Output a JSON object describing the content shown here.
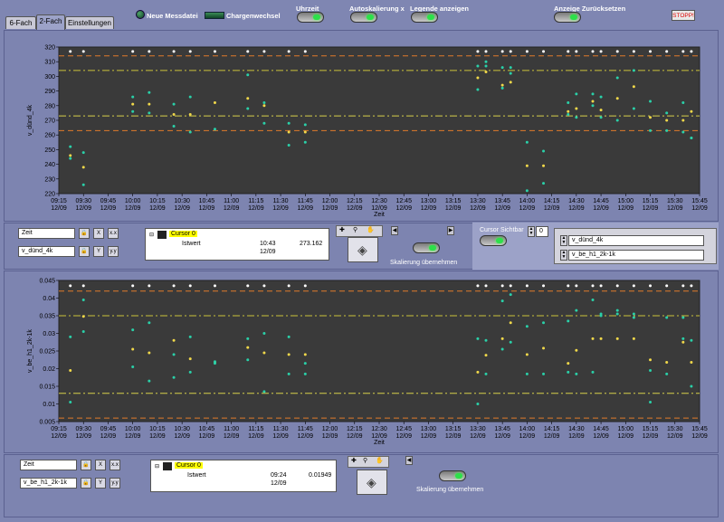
{
  "tabs": [
    "6-Fach",
    "2-Fach",
    "Einstellungen"
  ],
  "active_tab": 1,
  "header": {
    "new_file_label": "Neue Messdatei",
    "batch_change_label": "Chargenwechsel",
    "time_label": "Uhrzeit",
    "autoscale_label": "Autoskalierung x",
    "legend_label": "Legende anzeigen",
    "reset_label": "Anzeige Zurücksetzen",
    "stop_label": "STOPP!"
  },
  "chart_data": [
    {
      "type": "scatter",
      "title": "",
      "xlabel": "Zeit",
      "ylabel": "v_dünd_4k",
      "xticks": [
        "09:15\n12/09",
        "09:30\n12/09",
        "09:45\n12/09",
        "10:00\n12/09",
        "10:15\n12/09",
        "10:30\n12/09",
        "10:45\n12/09",
        "11:00\n12/09",
        "11:15\n12/09",
        "11:30\n12/09",
        "11:45\n12/09",
        "12:00\n12/09",
        "12:15\n12/09",
        "12:30\n12/09",
        "12:45\n12/09",
        "13:00\n12/09",
        "13:15\n12/09",
        "13:30\n12/09",
        "13:45\n12/09",
        "14:00\n12/09",
        "14:15\n12/09",
        "14:30\n12/09",
        "14:45\n12/09",
        "15:00\n12/09",
        "15:15\n12/09",
        "15:30\n12/09",
        "15:45\n12/09"
      ],
      "xlim": [
        555,
        945
      ],
      "ylim": [
        220,
        320
      ],
      "yticks": [
        220,
        230,
        240,
        250,
        260,
        270,
        280,
        290,
        300,
        310,
        320
      ],
      "hlines": [
        {
          "y": 314,
          "color": "#e07a2a",
          "style": "dash"
        },
        {
          "y": 304,
          "color": "#c9c23a",
          "style": "dashdot"
        },
        {
          "y": 273,
          "color": "#d6cf4a",
          "style": "dashdot"
        },
        {
          "y": 263,
          "color": "#e07a2a",
          "style": "dash"
        }
      ],
      "x": [
        562,
        570,
        580,
        600,
        610,
        625,
        635,
        650,
        670,
        680,
        695,
        705,
        775,
        785,
        790,
        800,
        810,
        815,
        825,
        830,
        840,
        850,
        865,
        870,
        880,
        885,
        895,
        905,
        915,
        925,
        935,
        940
      ],
      "series": [
        {
          "color": "#ffffff",
          "values": [
            317,
            317,
            null,
            317,
            317,
            317,
            317,
            317,
            317,
            317,
            317,
            317,
            null,
            null,
            null,
            null,
            317,
            317,
            317,
            317,
            317,
            317,
            317,
            317,
            317,
            317,
            317,
            317,
            317,
            317,
            317,
            317
          ]
        },
        {
          "color": "#f0d84a",
          "values": [
            246,
            238,
            null,
            281,
            281,
            274,
            274,
            282,
            285,
            280,
            262,
            262,
            null,
            null,
            null,
            null,
            299,
            303,
            294,
            296,
            239,
            239,
            276,
            278,
            283,
            277,
            285,
            293,
            272,
            270,
            270,
            276
          ]
        },
        {
          "color": "#2ad0a8",
          "values": [
            244,
            226,
            null,
            276,
            275,
            266,
            262,
            264,
            301,
            268,
            253,
            255,
            null,
            null,
            null,
            null,
            307,
            307,
            292,
            302,
            255,
            249,
            274,
            272,
            280,
            272,
            270,
            278,
            283,
            275,
            262,
            258
          ]
        },
        {
          "color": "#2ad0a8",
          "values": [
            252,
            248,
            null,
            286,
            289,
            281,
            286,
            null,
            278,
            282,
            268,
            267,
            null,
            null,
            null,
            null,
            291,
            310,
            306,
            306,
            222,
            227,
            282,
            288,
            288,
            286,
            299,
            304,
            263,
            263,
            282,
            258
          ]
        }
      ]
    },
    {
      "type": "scatter",
      "title": "",
      "xlabel": "Zeit",
      "ylabel": "v_be_h1_2k-1k",
      "xticks": [
        "09:15\n12/09",
        "09:30\n12/09",
        "09:45\n12/09",
        "10:00\n12/09",
        "10:15\n12/09",
        "10:30\n12/09",
        "10:45\n12/09",
        "11:00\n12/09",
        "11:15\n12/09",
        "11:30\n12/09",
        "11:45\n12/09",
        "12:00\n12/09",
        "12:15\n12/09",
        "12:30\n12/09",
        "12:45\n12/09",
        "13:00\n12/09",
        "13:15\n12/09",
        "13:30\n12/09",
        "13:45\n12/09",
        "14:00\n12/09",
        "14:15\n12/09",
        "14:30\n12/09",
        "14:45\n12/09",
        "15:00\n12/09",
        "15:15\n12/09",
        "15:30\n12/09",
        "15:45\n12/09"
      ],
      "xlim": [
        555,
        945
      ],
      "ylim": [
        0.005,
        0.045
      ],
      "yticks": [
        0.005,
        0.01,
        0.015,
        0.02,
        0.025,
        0.03,
        0.035,
        0.04,
        0.045
      ],
      "hlines": [
        {
          "y": 0.042,
          "color": "#e07a2a",
          "style": "dash"
        },
        {
          "y": 0.035,
          "color": "#c9c23a",
          "style": "dashdot"
        },
        {
          "y": 0.013,
          "color": "#d6cf4a",
          "style": "dashdot"
        },
        {
          "y": 0.006,
          "color": "#e07a2a",
          "style": "dash"
        }
      ],
      "x": [
        562,
        570,
        580,
        600,
        610,
        625,
        635,
        650,
        670,
        680,
        695,
        705,
        775,
        785,
        790,
        800,
        810,
        815,
        825,
        830,
        840,
        850,
        865,
        870,
        880,
        885,
        895,
        905,
        915,
        925,
        935,
        940
      ],
      "series": [
        {
          "color": "#ffffff",
          "values": [
            0.0435,
            0.0435,
            null,
            0.0435,
            0.0435,
            0.0435,
            0.0435,
            0.0435,
            0.0435,
            0.0435,
            0.0435,
            0.0435,
            null,
            null,
            null,
            null,
            0.0435,
            0.0435,
            0.0435,
            0.0435,
            0.0435,
            0.0435,
            0.0435,
            0.0435,
            0.0435,
            0.0435,
            0.0435,
            0.0435,
            0.0435,
            0.0435,
            0.0435,
            0.0435
          ]
        },
        {
          "color": "#f0d84a",
          "values": [
            0.0195,
            0.0348,
            null,
            0.0255,
            0.0245,
            0.028,
            0.0228,
            0.0218,
            0.026,
            0.0245,
            0.024,
            0.024,
            null,
            null,
            null,
            null,
            0.019,
            0.0238,
            0.0285,
            0.033,
            0.024,
            0.0258,
            0.0215,
            0.0252,
            0.0285,
            0.0285,
            0.0285,
            0.0285,
            0.0225,
            0.0218,
            0.0275,
            0.0218
          ]
        },
        {
          "color": "#2ad0a8",
          "values": [
            0.029,
            0.0395,
            null,
            0.031,
            0.033,
            0.024,
            0.029,
            0.0215,
            0.0225,
            0.03,
            0.029,
            0.0185,
            null,
            null,
            null,
            null,
            0.01,
            0.028,
            0.0392,
            0.041,
            0.032,
            0.033,
            0.0335,
            0.0365,
            0.0395,
            0.0355,
            0.0365,
            0.0355,
            0.0195,
            0.0185,
            0.0285,
            0.015
          ]
        },
        {
          "color": "#2ad0a8",
          "values": [
            0.0105,
            0.0305,
            null,
            0.0205,
            0.0165,
            0.0175,
            0.019,
            0.022,
            0.0285,
            0.0135,
            0.0185,
            0.0215,
            null,
            null,
            null,
            null,
            0.0285,
            0.0185,
            0.0255,
            0.0275,
            0.0185,
            0.0185,
            0.019,
            0.0185,
            0.019,
            0.035,
            0.0355,
            0.0345,
            0.0105,
            0.0345,
            0.0345,
            0.028
          ]
        }
      ]
    }
  ],
  "top_controls": {
    "x_field": "Zeit",
    "y_field": "v_dünd_4k",
    "cursor_name": "Cursor 0",
    "cursor_label": "Istwert",
    "cursor_time": "10:43\n12/09",
    "cursor_value": "273.162",
    "apply_scale_label": "Skalierung übernehmen",
    "cursor_visible_label": "Cursor Sichtbar",
    "cursor_index": "0",
    "legend_items": [
      "v_dünd_4k",
      "v_be_h1_2k-1k"
    ]
  },
  "bottom_controls": {
    "x_field": "Zeit",
    "y_field": "v_be_h1_2k-1k",
    "cursor_name": "Cursor 0",
    "cursor_label": "Istwert",
    "cursor_time": "09:24\n12/09",
    "cursor_value": "0.01949",
    "apply_scale_label": "Skalierung übernehmen"
  }
}
